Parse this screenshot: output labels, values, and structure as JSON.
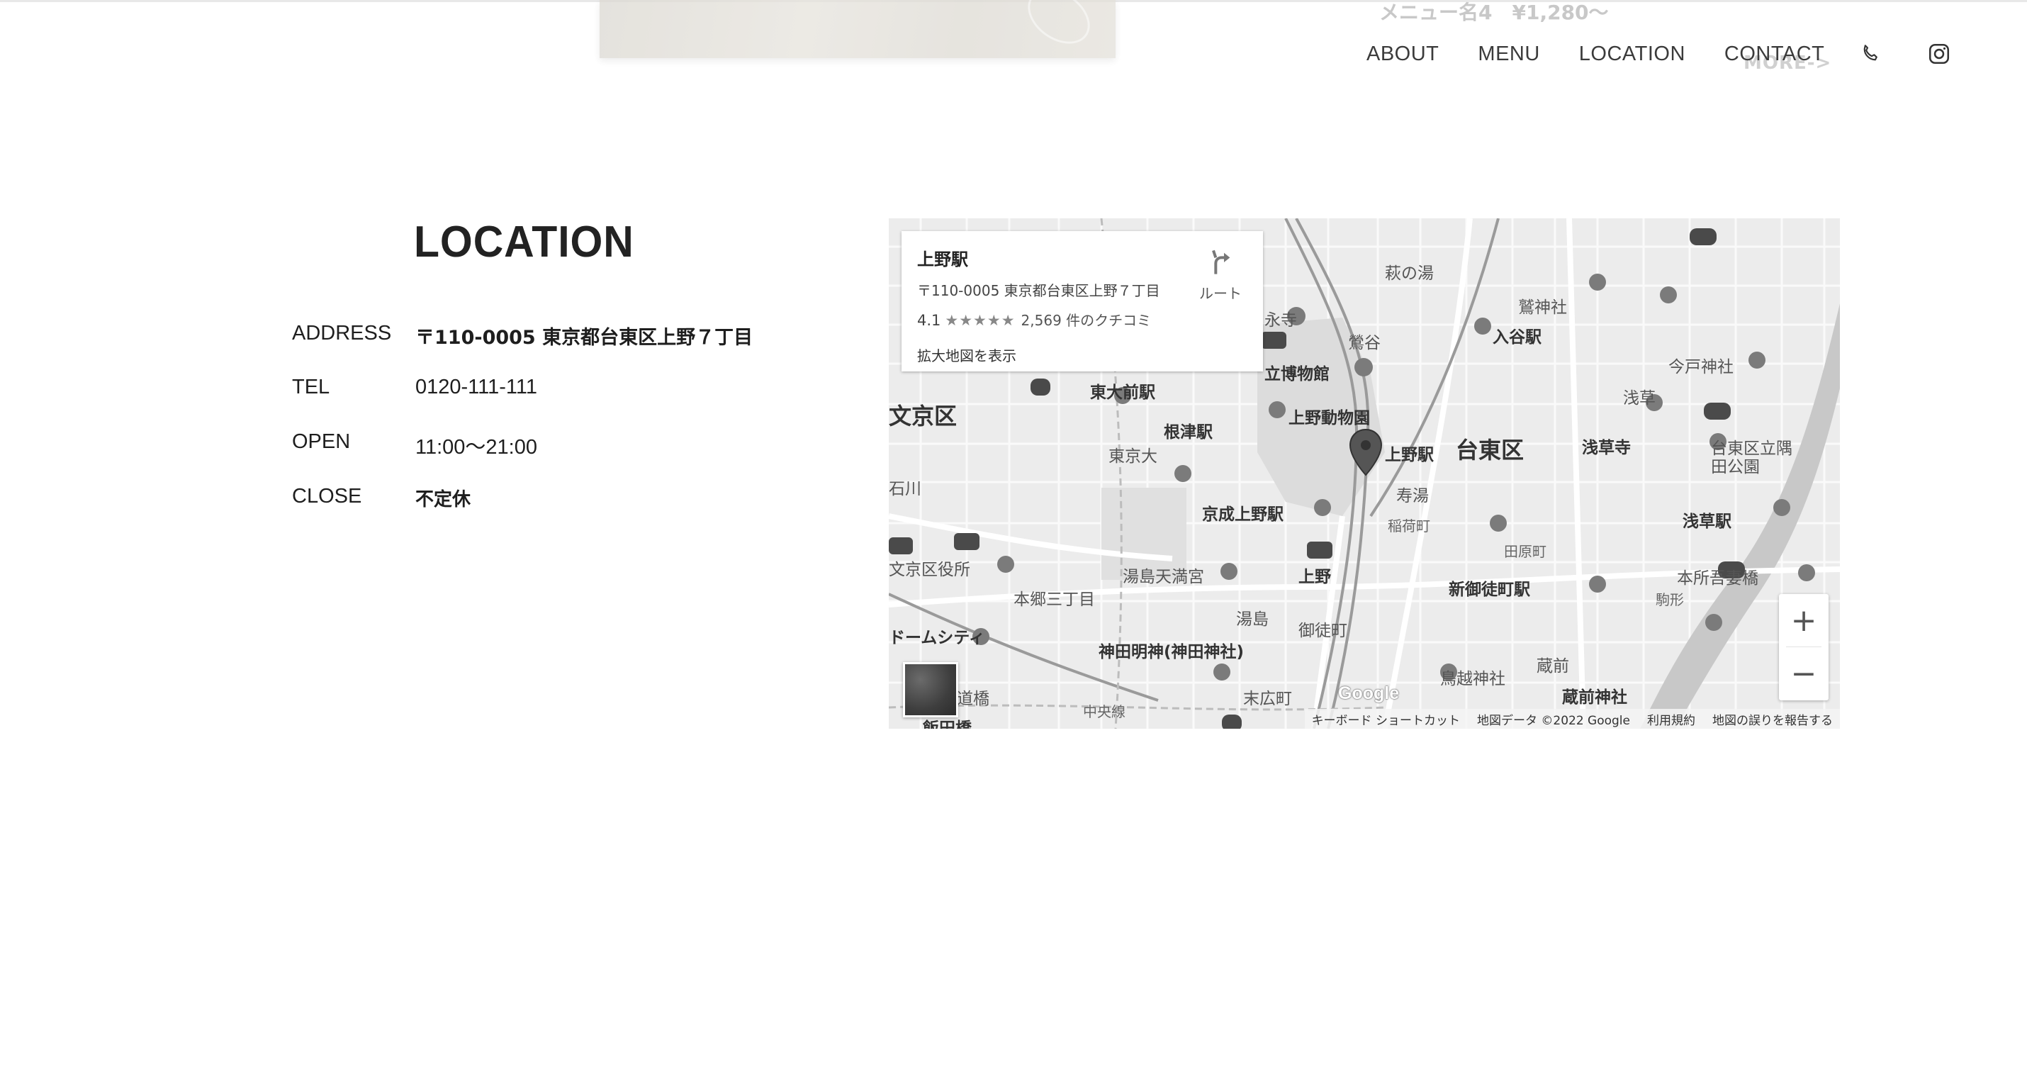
{
  "previous_section": {
    "menu_item": "メニュー名4　¥1,280～",
    "more_link": "MORE->"
  },
  "nav": {
    "items": [
      "ABOUT",
      "MENU",
      "LOCATION",
      "CONTACT"
    ],
    "icons": [
      "phone-icon",
      "instagram-icon"
    ]
  },
  "location": {
    "title": "LOCATION",
    "rows": [
      {
        "label": "ADDRESS",
        "value": "〒110-0005 東京都台東区上野７丁目"
      },
      {
        "label": "TEL",
        "value": "0120-111-111"
      },
      {
        "label": "OPEN",
        "value": "11:00〜21:00"
      },
      {
        "label": "CLOSE",
        "value": "不定休"
      }
    ]
  },
  "map": {
    "place": {
      "name": "上野駅",
      "address": "〒110-0005 東京都台東区上野７丁目",
      "rating": "4.1",
      "stars": "★★★★★",
      "stars_value": 4.1,
      "reviews": "2,569 件のクチコミ",
      "larger_map": "拡大地図を表示",
      "route": "ルート"
    },
    "labels": {
      "ward": "台東区",
      "bunkyo": "文京区",
      "ueno_station": "上野駅",
      "uguisudani": "鶯谷",
      "iriya": "入谷駅",
      "todaimae": "東大前駅",
      "nezu": "根津駅",
      "hakubutsukan": "立博物館",
      "zoo": "上野動物園",
      "keisei": "京成上野駅",
      "todai": "東京大",
      "kotobuki": "寿湯",
      "inaricho": "稲荷町",
      "shinokachimachi": "新御徒町駅",
      "yushima_tenmangu": "湯島天満宮",
      "hongo": "本郷三丁目",
      "kanda": "神田明神(神田神社)",
      "asakusa": "浅草駅",
      "sensoji": "浅草寺",
      "asakusa_area": "浅草",
      "imado": "今戸神社",
      "torigoe": "鳥越神社",
      "domecity": "ドームシティ",
      "bunkyo_office": "文京区役所",
      "hagi": "萩の湯",
      "washi": "鷲神社",
      "ueno": "上野",
      "yushima": "湯島",
      "okachimachi": "御徒町",
      "suehirocho": "末広町",
      "tawaramachi": "田原町",
      "kuramae": "蔵前",
      "kuramae_shrine": "蔵前神社",
      "sumida_park": "台東区立隅田公園",
      "honjo": "本所吾妻橋",
      "komagata": "駒形",
      "iidabashi": "飯田橋",
      "koishikawa": "石川",
      "eiji": "永寺",
      "chuo": "中央線",
      "suidobashi": "道橋"
    },
    "zoom_in": "+",
    "zoom_out": "−",
    "logo": "Google",
    "attribution": {
      "shortcuts": "キーボード ショートカット",
      "data": "地図データ ©2022 Google",
      "terms": "利用規約",
      "report": "地図の誤りを報告する"
    }
  }
}
